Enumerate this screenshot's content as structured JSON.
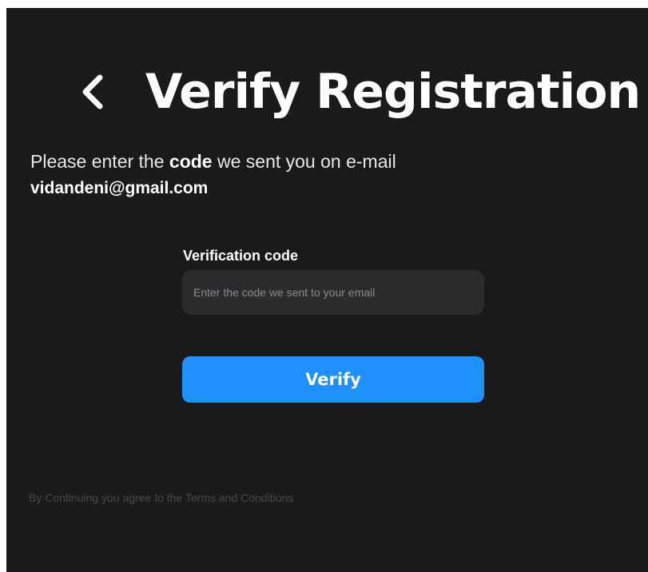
{
  "header": {
    "title": "Verify Registration",
    "back_icon": "chevron-left-icon"
  },
  "instructions": {
    "prefix": "Please enter the ",
    "emphasis": "code",
    "suffix": " we sent you on e-mail",
    "email": "vidandeni@gmail.com"
  },
  "form": {
    "label": "Verification code",
    "placeholder": "Enter the code we sent to your email",
    "value": "",
    "submit_label": "Verify"
  },
  "footer": {
    "terms": "By Continuing you agree to the Terms and Conditions"
  },
  "colors": {
    "background": "#1a1a1b",
    "input_background": "#2c2c2e",
    "accent": "#1e90ff",
    "text": "#ffffff",
    "muted_text": "#4a4a4d"
  }
}
